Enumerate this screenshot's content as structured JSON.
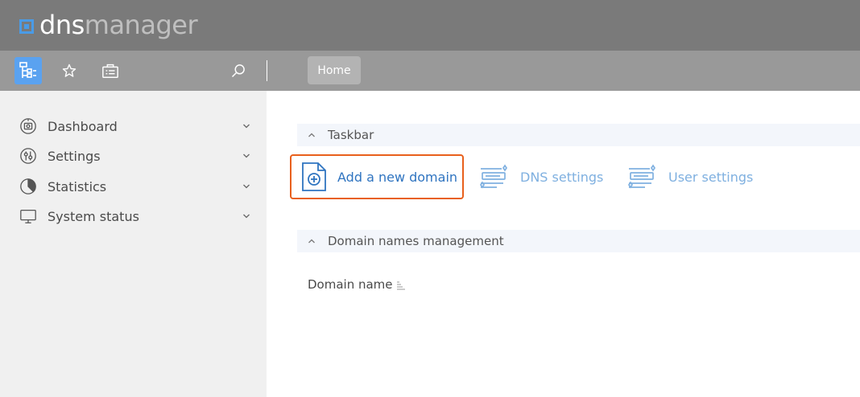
{
  "app": {
    "logo_part1": "dns",
    "logo_part2": "manager"
  },
  "toolbar": {
    "home_tab": "Home",
    "buttons": [
      "tree-menu-icon",
      "star-icon",
      "briefcase-icon",
      "search-icon"
    ]
  },
  "sidebar": {
    "items": [
      {
        "label": "Dashboard",
        "icon": "dashboard-icon"
      },
      {
        "label": "Settings",
        "icon": "settings-icon"
      },
      {
        "label": "Statistics",
        "icon": "pie-chart-icon"
      },
      {
        "label": "System status",
        "icon": "monitor-icon"
      }
    ]
  },
  "taskbar": {
    "title": "Taskbar",
    "buttons": [
      {
        "label": "Add a new domain",
        "icon": "add-document-icon"
      },
      {
        "label": "DNS settings",
        "icon": "list-settings-icon"
      },
      {
        "label": "User settings",
        "icon": "list-settings-icon"
      }
    ]
  },
  "domains": {
    "title": "Domain names management",
    "column_header": "Domain name"
  },
  "colors": {
    "header_bg": "#7a7a7a",
    "toolbar_bg": "#999999",
    "accent": "#5aa2f0",
    "link": "#2f74c0",
    "link_muted": "#7fb0e0",
    "highlight_border": "#e8601c"
  }
}
